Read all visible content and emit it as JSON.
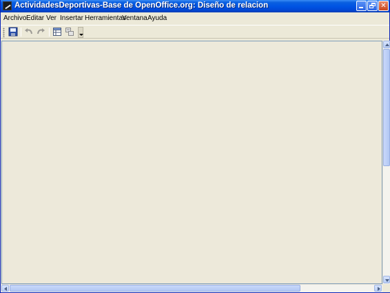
{
  "window": {
    "title": "ActividadesDeportivas-Base de OpenOffice.org: Diseño de relacion",
    "controls": {
      "minimize": "minimize-icon",
      "maximize": "restore-icon",
      "close": "close-icon"
    }
  },
  "menu": {
    "items": [
      {
        "label": "Archivo"
      },
      {
        "label": "Editar"
      },
      {
        "label": "Ver"
      },
      {
        "label": "Insertar"
      },
      {
        "label": "Herramientas"
      },
      {
        "label": "Ventana"
      },
      {
        "label": "Ayuda"
      }
    ]
  },
  "toolbar": {
    "buttons": [
      {
        "icon": "save-icon"
      },
      {
        "icon": "undo-icon"
      },
      {
        "icon": "redo-icon"
      },
      {
        "icon": "add-tables-icon"
      },
      {
        "icon": "new-relation-icon"
      }
    ],
    "overflow": "toolbar-options-icon"
  },
  "colors": {
    "titlebar": "#0054E3",
    "workspace": "#EDE9DA",
    "chrome": "#ECE9D8"
  }
}
